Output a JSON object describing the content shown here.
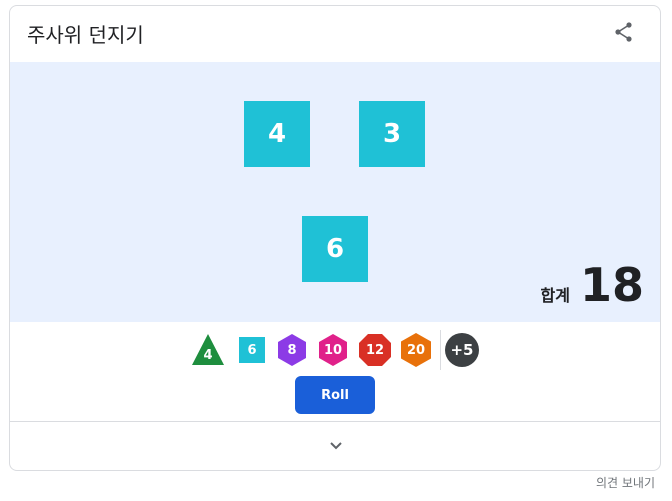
{
  "widget": {
    "title": "주사위 던지기",
    "share_icon": "share-icon"
  },
  "dice_results": [
    "4",
    "3",
    "6"
  ],
  "total": {
    "label": "합계",
    "value": "18"
  },
  "die_types": [
    {
      "label": "4",
      "shape": "triangle",
      "color": "#1e8e3e"
    },
    {
      "label": "6",
      "shape": "square",
      "color": "#1fc1d6",
      "selected": true
    },
    {
      "label": "8",
      "shape": "hexagon",
      "color": "#8c3be6"
    },
    {
      "label": "10",
      "shape": "hexagon",
      "color": "#e0218a"
    },
    {
      "label": "12",
      "shape": "octagon",
      "color": "#d93025"
    },
    {
      "label": "20",
      "shape": "hexagon",
      "color": "#e8710a"
    }
  ],
  "modifier": {
    "label": "+5",
    "color": "#3c4043"
  },
  "roll_button": "Roll",
  "expand_icon": "chevron-down-icon",
  "feedback_link": "의견 보내기",
  "colors": {
    "stage_bg": "#e8f0fe",
    "die_color": "#1fc1d6",
    "roll_button": "#1a5fd9"
  }
}
